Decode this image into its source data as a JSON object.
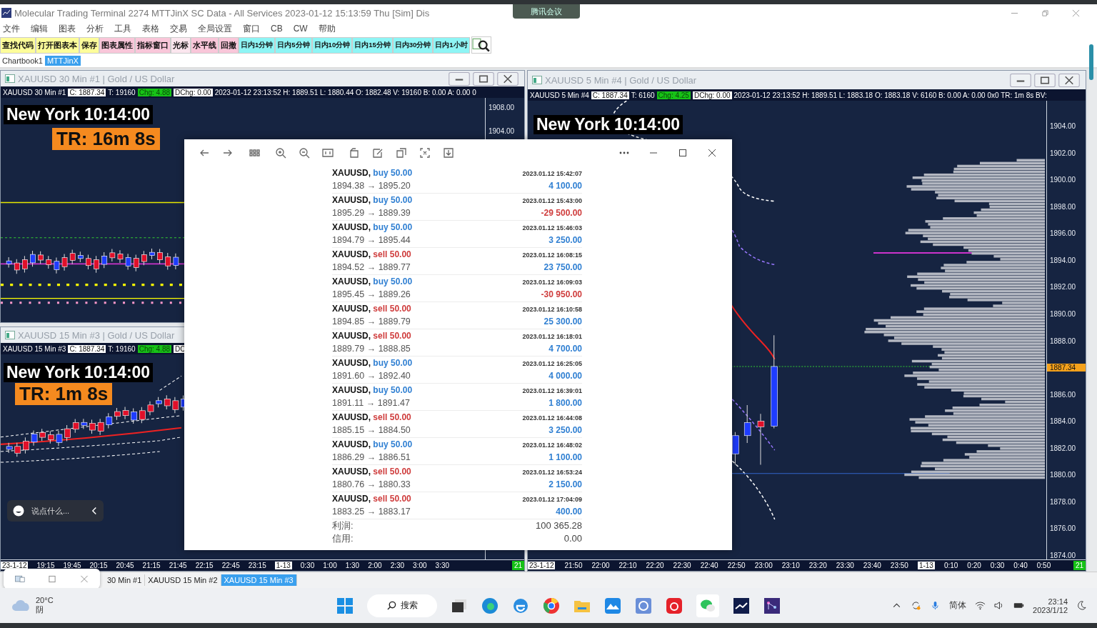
{
  "window": {
    "title": "Molecular Trading Terminal 2274 MTTJinX  SC Data - All Services 2023-01-12  15:13:59 Thu [Sim]  Dis"
  },
  "meeting_badge": "腾讯会议",
  "menu": [
    "文件",
    "编辑",
    "图表",
    "分析",
    "工具",
    "表格",
    "交易",
    "全局设置",
    "窗口",
    "CB",
    "CW",
    "帮助"
  ],
  "toolbar": [
    {
      "label": "查找代码",
      "color": "#fdfd9a"
    },
    {
      "label": "打开图表本",
      "color": "#fdfd9a"
    },
    {
      "label": "保存",
      "color": "#fdfd9a"
    },
    {
      "label": "图表属性",
      "color": "#f9c6d9"
    },
    {
      "label": "指标窗口",
      "color": "#f9c6d9"
    },
    {
      "label": "光标",
      "color": "#fbe6ee"
    },
    {
      "label": "水平线",
      "color": "#f9c6d9"
    },
    {
      "label": "回撤",
      "color": "#f9c6d9"
    },
    {
      "label": "日内1分钟",
      "color": "#8ef5f5"
    },
    {
      "label": "日内5分钟",
      "color": "#8ef5f5"
    },
    {
      "label": "日内10分钟",
      "color": "#8ef5f5"
    },
    {
      "label": "日内15分钟",
      "color": "#8ef5f5"
    },
    {
      "label": "日内30分钟",
      "color": "#8ef5f5"
    },
    {
      "label": "日内1小时",
      "color": "#8ef5f5"
    }
  ],
  "chartbook_tabs": [
    {
      "label": "Chartbook1",
      "selected": false
    },
    {
      "label": "MTTJinX",
      "selected": true
    }
  ],
  "charts": [
    {
      "title": "XAUUSD  30 Min   #1 | Gold / US Dollar",
      "symbol": "XAUUSD  30 Min   #1",
      "close": "C: 1887.34",
      "trades": "T: 19160",
      "change": "Chg: 4.88",
      "day_change": "DChg: 0.00",
      "details": "2023-01-12 23:13:52 H: 1889.51 L: 1880.44 O: 1882.48 V: 19160 B: 0.00 A: 0.00 0",
      "clock": "New York 10:14:00",
      "timer": "TR: 16m 8s",
      "kind": "m30",
      "price_labels": [
        {
          "label": "1908.00",
          "kind": "tick"
        },
        {
          "label": "1904.00",
          "kind": "tick"
        }
      ]
    },
    {
      "title": "XAUUSD  15 Min   #3 | Gold / US Dollar",
      "symbol": "XAUUSD  15 Min   #3",
      "close": "C: 1887.34",
      "trades": "T: 19160",
      "change": "Chg: 4.88",
      "day_change": "DC",
      "clock": "New York 10:14:00",
      "timer": "TR: 1m 8s",
      "kind": "m15",
      "time_labels": [
        {
          "label": "23-1-12",
          "kind": "date"
        },
        {
          "label": "19:15",
          "kind": "time"
        },
        {
          "label": "19:45",
          "kind": "time"
        },
        {
          "label": "20:15",
          "kind": "time"
        },
        {
          "label": "20:45",
          "kind": "time"
        },
        {
          "label": "21:15",
          "kind": "time"
        },
        {
          "label": "21:45",
          "kind": "time"
        },
        {
          "label": "22:15",
          "kind": "time"
        },
        {
          "label": "22:45",
          "kind": "time"
        },
        {
          "label": "23:15",
          "kind": "time"
        },
        {
          "label": "1-13",
          "kind": "date"
        },
        {
          "label": "0:30",
          "kind": "time"
        },
        {
          "label": "1:00",
          "kind": "time"
        },
        {
          "label": "1:30",
          "kind": "time"
        },
        {
          "label": "2:00",
          "kind": "time"
        },
        {
          "label": "2:30",
          "kind": "time"
        },
        {
          "label": "3:00",
          "kind": "time"
        },
        {
          "label": "3:30",
          "kind": "time"
        }
      ],
      "bar_count": "21"
    },
    {
      "title": "XAUUSD  5 Min   #4 | Gold / US Dollar",
      "symbol": "XAUUSD  5 Min   #4",
      "close": "C: 1887.34",
      "trades": "T: 6160",
      "change": "Chg: 4.25",
      "day_change": "DChg: 0.00",
      "details": "2023-01-12 23:13:52 H: 1889.51 L: 1883.18 O: 1883.18 V: 6160 B: 0.00 A: 0.00 0x0 TR: 1m 8s BV:",
      "clock": "New York 10:14:00",
      "kind": "m5",
      "price_labels": [
        {
          "label": "1904.00",
          "kind": "tick"
        },
        {
          "label": "1902.00",
          "kind": "tick"
        },
        {
          "label": "1900.00",
          "kind": "tick"
        },
        {
          "label": "1898.00",
          "kind": "tick"
        },
        {
          "label": "1896.00",
          "kind": "tick"
        },
        {
          "label": "1894.00",
          "kind": "tick"
        },
        {
          "label": "1892.00",
          "kind": "tick"
        },
        {
          "label": "1890.00",
          "kind": "tick"
        },
        {
          "label": "1888.00",
          "kind": "tick"
        },
        {
          "label": "1887.34",
          "kind": "current"
        },
        {
          "label": "1886.00",
          "kind": "tick"
        },
        {
          "label": "1884.00",
          "kind": "tick"
        },
        {
          "label": "1882.00",
          "kind": "tick"
        },
        {
          "label": "1880.00",
          "kind": "tick"
        },
        {
          "label": "1878.00",
          "kind": "tick"
        },
        {
          "label": "1876.00",
          "kind": "tick"
        },
        {
          "label": "1874.00",
          "kind": "tick"
        }
      ],
      "time_labels": [
        {
          "label": "23-1-12",
          "kind": "date"
        },
        {
          "label": "21:50",
          "kind": "time"
        },
        {
          "label": "22:00",
          "kind": "time"
        },
        {
          "label": "22:10",
          "kind": "time"
        },
        {
          "label": "22:20",
          "kind": "time"
        },
        {
          "label": "22:30",
          "kind": "time"
        },
        {
          "label": "22:40",
          "kind": "time"
        },
        {
          "label": "22:50",
          "kind": "time"
        },
        {
          "label": "23:00",
          "kind": "time"
        },
        {
          "label": "23:10",
          "kind": "time"
        },
        {
          "label": "23:20",
          "kind": "time"
        },
        {
          "label": "23:30",
          "kind": "time"
        },
        {
          "label": "23:40",
          "kind": "time"
        },
        {
          "label": "23:50",
          "kind": "time"
        },
        {
          "label": "1-13",
          "kind": "date"
        },
        {
          "label": "0:10",
          "kind": "time"
        },
        {
          "label": "0:20",
          "kind": "time"
        },
        {
          "label": "0:30",
          "kind": "time"
        },
        {
          "label": "0:40",
          "kind": "time"
        },
        {
          "label": "0:50",
          "kind": "time"
        }
      ],
      "bar_count": "21"
    }
  ],
  "chat_box": {
    "placeholder": "说点什么..."
  },
  "report": {
    "trades": [
      {
        "symbol": "XAUUSD,",
        "action": "buy 50.00",
        "kind": "buy",
        "time": "2023.01.12 15:42:07",
        "prices": "1894.38 → 1895.20",
        "profit": "4 100.00",
        "loss": false
      },
      {
        "symbol": "XAUUSD,",
        "action": "buy 50.00",
        "kind": "buy",
        "time": "2023.01.12 15:43:00",
        "prices": "1895.29 → 1889.39",
        "profit": "-29 500.00",
        "loss": true
      },
      {
        "symbol": "XAUUSD,",
        "action": "buy 50.00",
        "kind": "buy",
        "time": "2023.01.12 15:46:03",
        "prices": "1894.79 → 1895.44",
        "profit": "3 250.00",
        "loss": false
      },
      {
        "symbol": "XAUUSD,",
        "action": "sell 50.00",
        "kind": "sell",
        "time": "2023.01.12 16:08:15",
        "prices": "1894.52 → 1889.77",
        "profit": "23 750.00",
        "loss": false
      },
      {
        "symbol": "XAUUSD,",
        "action": "buy 50.00",
        "kind": "buy",
        "time": "2023.01.12 16:09:03",
        "prices": "1895.45 → 1889.26",
        "profit": "-30 950.00",
        "loss": true
      },
      {
        "symbol": "XAUUSD,",
        "action": "sell 50.00",
        "kind": "sell",
        "time": "2023.01.12 16:10:58",
        "prices": "1894.85 → 1889.79",
        "profit": "25 300.00",
        "loss": false
      },
      {
        "symbol": "XAUUSD,",
        "action": "sell 50.00",
        "kind": "sell",
        "time": "2023.01.12 16:18:01",
        "prices": "1889.79 → 1888.85",
        "profit": "4 700.00",
        "loss": false
      },
      {
        "symbol": "XAUUSD,",
        "action": "buy 50.00",
        "kind": "buy",
        "time": "2023.01.12 16:25:05",
        "prices": "1891.60 → 1892.40",
        "profit": "4 000.00",
        "loss": false
      },
      {
        "symbol": "XAUUSD,",
        "action": "buy 50.00",
        "kind": "buy",
        "time": "2023.01.12 16:39:01",
        "prices": "1891.11 → 1891.47",
        "profit": "1 800.00",
        "loss": false
      },
      {
        "symbol": "XAUUSD,",
        "action": "sell 50.00",
        "kind": "sell",
        "time": "2023.01.12 16:44:08",
        "prices": "1885.15 → 1884.50",
        "profit": "3 250.00",
        "loss": false
      },
      {
        "symbol": "XAUUSD,",
        "action": "buy 50.00",
        "kind": "buy",
        "time": "2023.01.12 16:48:02",
        "prices": "1886.29 → 1886.51",
        "profit": "1 100.00",
        "loss": false
      },
      {
        "symbol": "XAUUSD,",
        "action": "sell 50.00",
        "kind": "sell",
        "time": "2023.01.12 16:53:24",
        "prices": "1880.76 → 1880.33",
        "profit": "2 150.00",
        "loss": false
      },
      {
        "symbol": "XAUUSD,",
        "action": "sell 50.00",
        "kind": "sell",
        "time": "2023.01.12 17:04:09",
        "prices": "1883.25 → 1883.17",
        "profit": "400.00",
        "loss": false
      }
    ],
    "summary": [
      {
        "label": "利润:",
        "value": "100 365.28"
      },
      {
        "label": "信用:",
        "value": "0.00"
      }
    ]
  },
  "chart_tabs": [
    {
      "label": "30 Min  #1",
      "selected": false
    },
    {
      "label": "XAUUSD  15 Min  #2",
      "selected": false
    },
    {
      "label": "XAUUSD  15 Min  #3",
      "selected": true
    }
  ],
  "taskbar": {
    "temperature": "20°C",
    "condition": "阴",
    "search": "搜索",
    "input_method": "简体",
    "time": "23:14",
    "date": "2023/1/12"
  }
}
